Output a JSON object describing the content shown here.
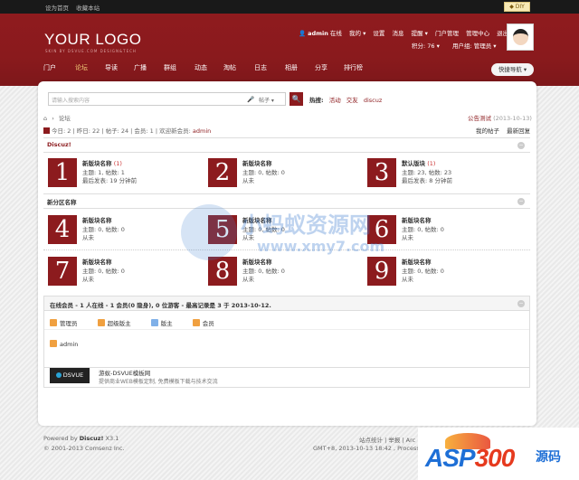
{
  "topbar": {
    "home": "设为首页",
    "fav": "收藏本站",
    "diy": "◆ DIY"
  },
  "header": {
    "logo": "YOUR LOGO",
    "slogan": "SKIN BY DSVUE.COM DESIGN&TECH",
    "username": "admin",
    "online": "在线",
    "my": "我的 ▾",
    "settings": "设置",
    "messages": "消息",
    "reminders": "提醒 ▾",
    "portal_admin": "门户管理",
    "manage": "管理中心",
    "logout": "退出",
    "points": "积分: 76 ▾",
    "group": "用户组: 管理员 ▾"
  },
  "nav": {
    "items": [
      "门户",
      "论坛",
      "导读",
      "广播",
      "群组",
      "动态",
      "淘帖",
      "日志",
      "相册",
      "分享",
      "排行榜"
    ],
    "quick": "快捷导航 ▾"
  },
  "search": {
    "placeholder": "请输入搜索内容",
    "mic": "🎤",
    "type": "帖子 ▾",
    "button": "🔍",
    "hot_label": "热搜:",
    "hot": [
      "活动",
      "交友",
      "discuz"
    ]
  },
  "crumb": {
    "home": "⌂",
    "sep": "›",
    "page": "论坛"
  },
  "notice": {
    "title": "公告测试",
    "date": "(2013-10-13)"
  },
  "stats": {
    "text": "今日: 2 | 昨日: 22 | 帖子: 24 | 会员: 1 | 欢迎新会员: ",
    "newuser": "admin"
  },
  "mylinks": {
    "myposts": "我的帖子",
    "latest": "最新回复"
  },
  "categories": [
    {
      "name": "Discuz!",
      "toggle": "−"
    },
    {
      "name": "新分区名称",
      "toggle": "−"
    }
  ],
  "forums": [
    {
      "num": "1",
      "name": "新版块名称",
      "new": "(1)",
      "l2": "主题: 1, 帖数: 1",
      "l3": "最后发表: 19 分钟前"
    },
    {
      "num": "2",
      "name": "新版块名称",
      "new": "",
      "l2": "主题: 0, 帖数: 0",
      "l3": "从未"
    },
    {
      "num": "3",
      "name": "默认版块",
      "new": "(1)",
      "l2": "主题: 23, 帖数: 23",
      "l3": "最后发表: 8 分钟前"
    },
    {
      "num": "4",
      "name": "新版块名称",
      "new": "",
      "l2": "主题: 0, 帖数: 0",
      "l3": "从未"
    },
    {
      "num": "5",
      "name": "新版块名称",
      "new": "",
      "l2": "主题: 0, 帖数: 0",
      "l3": "从未"
    },
    {
      "num": "6",
      "name": "新版块名称",
      "new": "",
      "l2": "主题: 0, 帖数: 0",
      "l3": "从未"
    },
    {
      "num": "7",
      "name": "新版块名称",
      "new": "",
      "l2": "主题: 0, 帖数: 0",
      "l3": "从未"
    },
    {
      "num": "8",
      "name": "新版块名称",
      "new": "",
      "l2": "主题: 0, 帖数: 0",
      "l3": "从未"
    },
    {
      "num": "9",
      "name": "新版块名称",
      "new": "",
      "l2": "主题: 0, 帖数: 0",
      "l3": "从未"
    }
  ],
  "online": {
    "title": "在线会员 - 1 人在线 - 1 会员(0 隐身), 0 位游客 - 最高记录是 3 于 2013-10-12.",
    "toggle": "−",
    "legend": [
      "管理员",
      "超级版主",
      "版主",
      "会员"
    ],
    "legend_colors": [
      "#f0a040",
      "#f0a040",
      "#7fb0e8",
      "#f0a040"
    ],
    "user": "admin"
  },
  "friendlink": {
    "logo": "DSVUE",
    "title": "游蚁-DSVUE模板网",
    "desc": "提供商业WEB模板定制, 免费模板下载与技术交流"
  },
  "footer": {
    "powered": "Powered by ",
    "product": "Discuz!",
    "version": " X3.1",
    "copyright": "© 2001-2013 Comsenz Inc.",
    "r1": "站点统计 | 举报 | Arc",
    "r2": "GMT+8, 2013-10-13 18:42 , Processe"
  },
  "watermark": {
    "t1": "小蚂蚁资源网",
    "t2": "www.xmy7.com"
  },
  "asp": {
    "text1": "ASP",
    "text2": "300",
    "text3": "源码"
  },
  "colors": {
    "brand": "#8c1b1e",
    "header": "#8a1a1d"
  }
}
